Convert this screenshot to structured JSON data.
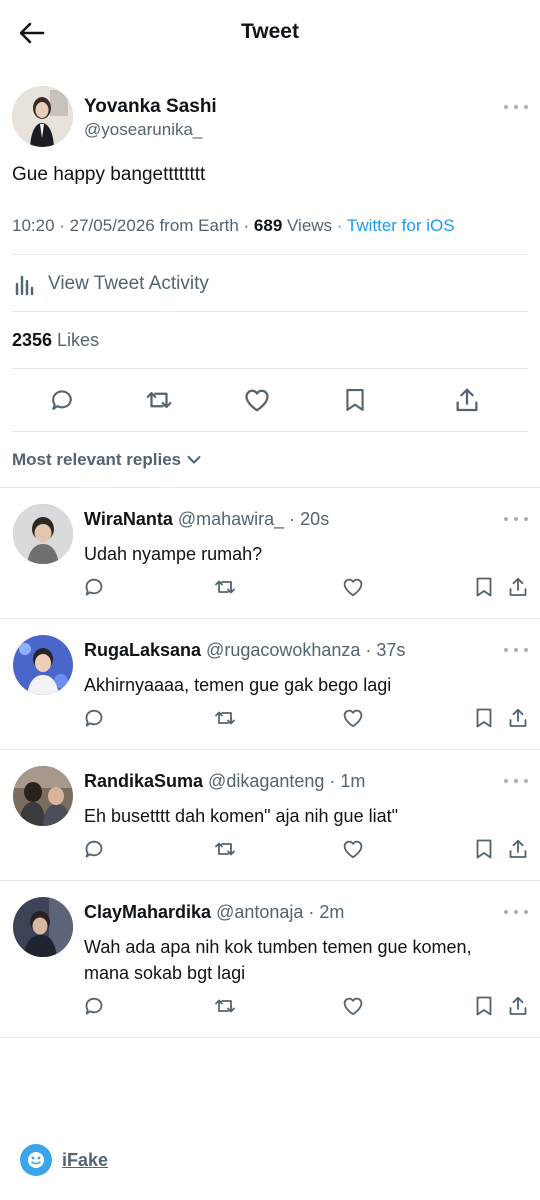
{
  "header": {
    "title": "Tweet"
  },
  "tweet": {
    "author_name": "Yovanka Sashi",
    "author_handle": "@yosearunika_",
    "text": "Gue happy bangetttttttt",
    "time": "10:20 · 27/05/2026 from Earth · ",
    "views_count": "689",
    "views_label": " Views ",
    "source": "· Twitter for iOS",
    "activity_label": "View Tweet Activity",
    "likes_count": "2356",
    "likes_label": " Likes"
  },
  "replies_sort": {
    "label": "Most relevant replies"
  },
  "replies": [
    {
      "name": "WiraNanta",
      "meta": " @mahawira_ · 20s",
      "lines": [
        "Udah nyampe rumah?"
      ],
      "avatar_color": "#8a8f96"
    },
    {
      "name": "RugaLaksana",
      "meta": " @rugacowokhanza · 37s",
      "lines": [
        "Akhirnyaaaa, temen gue gak bego lagi"
      ],
      "avatar_color": "#4a66c9"
    },
    {
      "name": "RandikaSuma",
      "meta": " @dikaganteng · 1m",
      "lines": [
        "Eh busetttt dah komen\" aja nih gue liat\""
      ],
      "avatar_color": "#6b5a4e"
    },
    {
      "name": "ClayMahardika",
      "meta": " @antonaja · 2m",
      "lines": [
        "Wah ada apa nih kok tumben temen gue komen,",
        "mana sokab bgt lagi"
      ],
      "avatar_color": "#3c4356"
    }
  ],
  "brand": {
    "label": "iFake",
    "color": "#3aa5e8"
  },
  "icons": [
    "back-arrow-icon",
    "more-icon",
    "activity-bars-icon",
    "reply-icon",
    "retweet-icon",
    "like-icon",
    "bookmark-icon",
    "share-icon",
    "chevron-down-icon",
    "ifake-logo-icon"
  ]
}
